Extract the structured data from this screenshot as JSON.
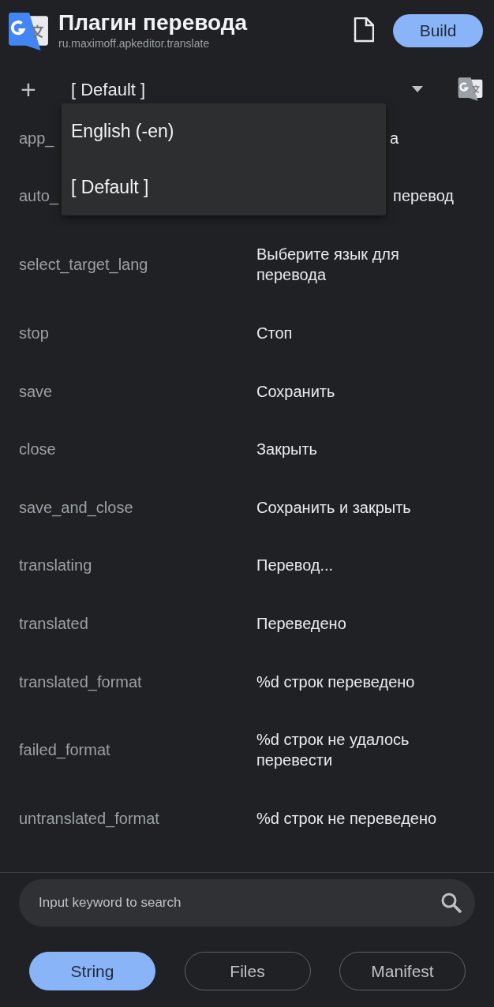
{
  "header": {
    "title": "Плагин перевода",
    "subtitle": "ru.maximoff.apkeditor.translate",
    "build_button": "Build"
  },
  "toolbar": {
    "add": "+",
    "language": "[ Default ]"
  },
  "dropdown": {
    "options": [
      {
        "label": "English (-en)"
      },
      {
        "label": "[ Default ]"
      }
    ]
  },
  "covered_rows": [
    {
      "key": "app_",
      "value": "а"
    },
    {
      "key": "auto_",
      "value": "перевод"
    }
  ],
  "rows": [
    {
      "key": "select_target_lang",
      "value": "Выберите язык для перевода"
    },
    {
      "key": "stop",
      "value": "Стоп"
    },
    {
      "key": "save",
      "value": "Сохранить"
    },
    {
      "key": "close",
      "value": "Закрыть"
    },
    {
      "key": "save_and_close",
      "value": "Сохранить и закрыть"
    },
    {
      "key": "translating",
      "value": "Перевод..."
    },
    {
      "key": "translated",
      "value": "Переведено"
    },
    {
      "key": "translated_format",
      "value": "%d строк переведено"
    },
    {
      "key": "failed_format",
      "value": "%d строк не удалось перевести"
    },
    {
      "key": "untranslated_format",
      "value": "%d строк не переведено"
    }
  ],
  "search": {
    "placeholder": "Input keyword to search"
  },
  "tabs": [
    {
      "label": "String",
      "selected": true
    },
    {
      "label": "Files",
      "selected": false
    },
    {
      "label": "Manifest",
      "selected": false
    }
  ]
}
